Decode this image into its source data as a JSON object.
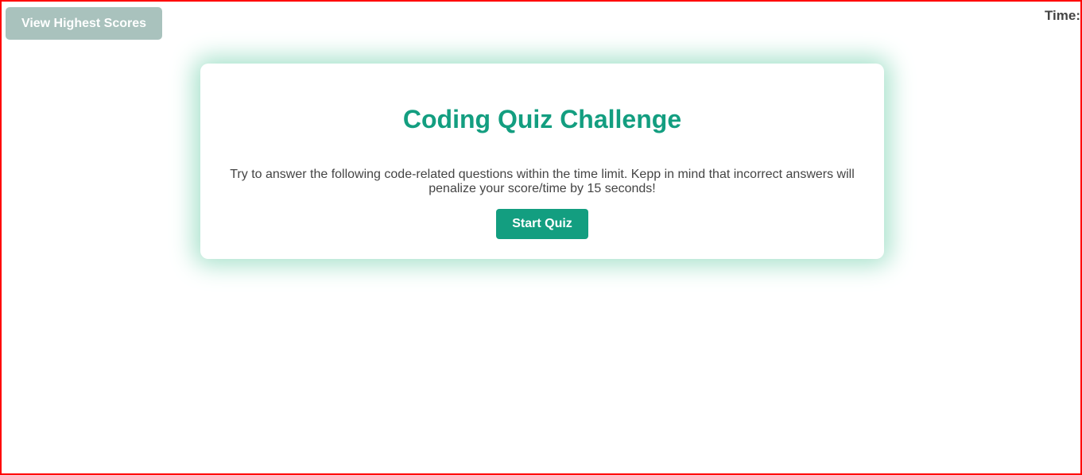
{
  "header": {
    "highscores_label": "View Highest Scores",
    "time_label": "Time:"
  },
  "card": {
    "title": "Coding Quiz Challenge",
    "description": "Try to answer the following code-related questions within the time limit. Kepp in mind that incorrect answers will penalize your score/time by 15 seconds!",
    "start_label": "Start Quiz"
  },
  "colors": {
    "accent": "#139e80",
    "muted_button": "#a9c2bd"
  }
}
